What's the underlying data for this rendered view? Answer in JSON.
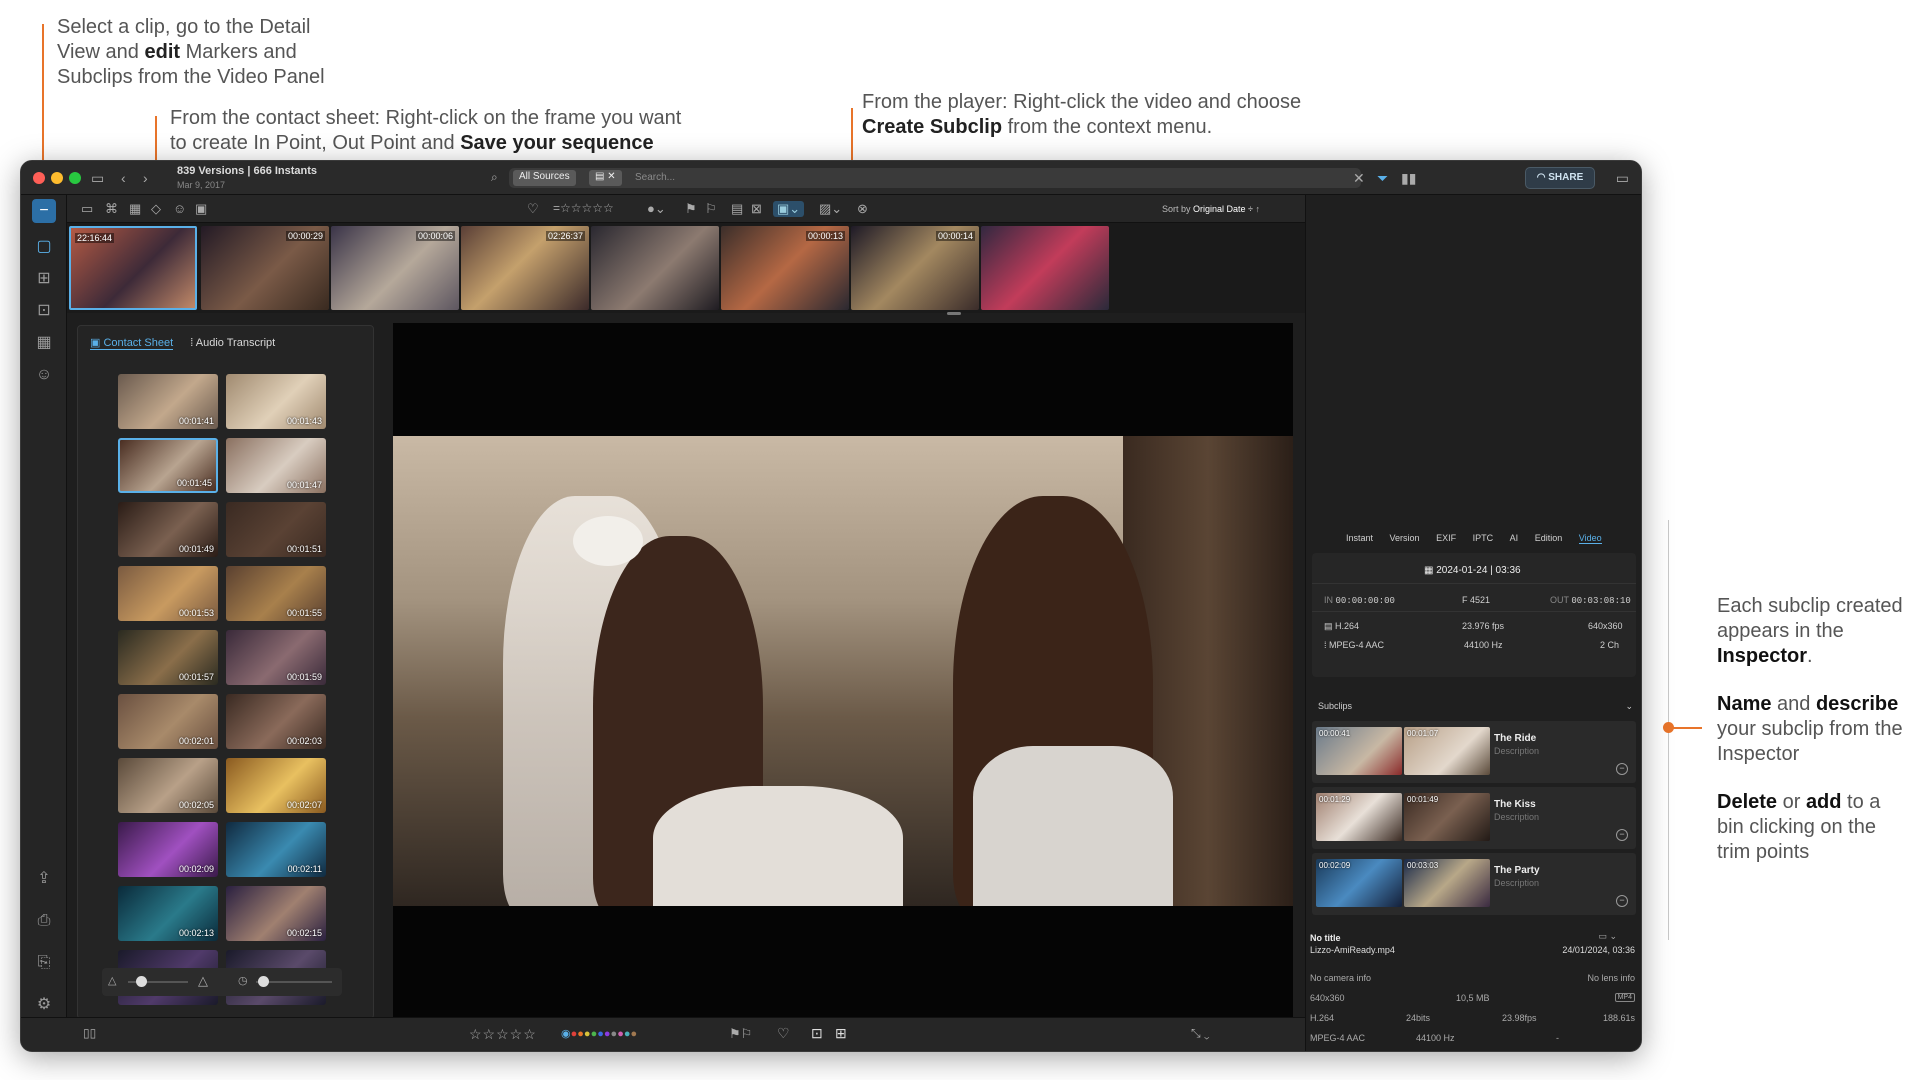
{
  "annotations": {
    "left_top": {
      "pre": "Select a clip, go to the Detail View and ",
      "bold": "edit",
      "post": " Markers and Subclips from the Video Panel"
    },
    "contact": {
      "line1": "From the contact sheet: Right-click on the frame you want",
      "pre2": "to create In Point, Out Point and ",
      "bold": "Save your sequence"
    },
    "player": {
      "line1": "From the player: Right-click the video and choose",
      "bold": "Create Subclip",
      "post": " from the context menu."
    },
    "right1": {
      "pre": "Each subclip created appears in the ",
      "bold": "Inspector",
      "post": "."
    },
    "right2": {
      "bold1": "Name",
      "mid": " and ",
      "bold2": "describe",
      "post": " your subclip from the Inspector"
    },
    "right3": {
      "bold1": "Delete",
      "mid": " or ",
      "bold2": "add",
      "post": " to a bin clicking on the trim points"
    }
  },
  "colors": {
    "accent": "#e8742a",
    "link": "#4aa6e8",
    "window_bg": "#1e1e1e"
  },
  "titlebar": {
    "title": "839 Versions | 666 Instants",
    "subtitle": "Mar 9, 2017",
    "source_chip": "All Sources",
    "search_placeholder": "Search...",
    "share": "SHARE"
  },
  "toolbar": {
    "sort_label": "Sort by",
    "sort_value": "Original Date ÷"
  },
  "strip": {
    "timecodes": [
      "22:16:44",
      "00:00:29",
      "00:00:06",
      "02:26:37",
      "",
      "00:00:13",
      "00:00:14",
      ""
    ]
  },
  "sheet": {
    "tab_contact": "Contact Sheet",
    "tab_audio": "Audio Transcript",
    "times": [
      "00:01:41",
      "00:01:43",
      "00:01:45",
      "00:01:47",
      "00:01:49",
      "00:01:51",
      "00:01:53",
      "00:01:55",
      "00:01:57",
      "00:01:59",
      "00:02:01",
      "00:02:03",
      "00:02:05",
      "00:02:07",
      "00:02:09",
      "00:02:11",
      "00:02:13",
      "00:02:15",
      "",
      ""
    ]
  },
  "inspector": {
    "tabs": [
      "Instant",
      "Version",
      "EXIF",
      "IPTC",
      "AI",
      "Edition",
      "Video"
    ],
    "active_tab": "Video",
    "date": "2024-01-24 | 03:36",
    "in_label": "IN",
    "in_value": "00:00:00:00",
    "frames": "F 4521",
    "out_label": "OUT",
    "out_value": "00:03:08:10",
    "video_codec": "H.264",
    "fps": "23.976 fps",
    "resolution": "640x360",
    "audio_codec": "MPEG-4 AAC",
    "sample_rate": "44100 Hz",
    "channels": "2 Ch",
    "subclips_label": "Subclips",
    "subclips": [
      {
        "in": "00:00:41",
        "out": "00:01:07",
        "name": "The Ride",
        "desc": "Description"
      },
      {
        "in": "00:01:29",
        "out": "00:01:49",
        "name": "The Kiss",
        "desc": "Description"
      },
      {
        "in": "00:02:09",
        "out": "00:03:03",
        "name": "The Party",
        "desc": "Description"
      }
    ],
    "no_title": "No title",
    "filename": "Lizzo-AmiReady.mp4",
    "file_date": "24/01/2024, 03:36",
    "no_camera": "No camera info",
    "no_lens": "No lens info",
    "dims": "640x360",
    "size": "10,5 MB",
    "container": "MP4",
    "codec2": "H.264",
    "bits": "24bits",
    "fps2": "23.98fps",
    "bitrate": "188.61s",
    "audio2": "MPEG-4 AAC",
    "hz2": "44100 Hz",
    "dash": "-"
  }
}
